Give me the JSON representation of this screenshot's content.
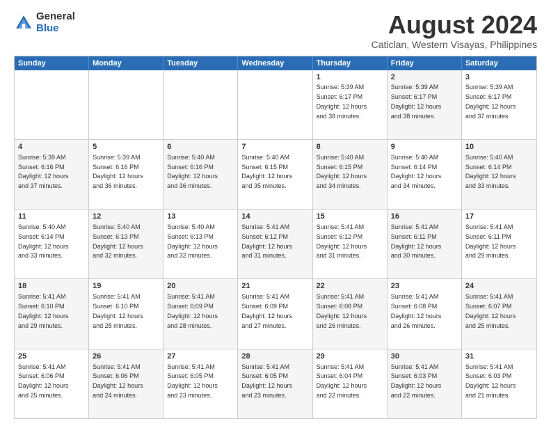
{
  "logo": {
    "general": "General",
    "blue": "Blue"
  },
  "title": "August 2024",
  "location": "Caticlan, Western Visayas, Philippines",
  "header_days": [
    "Sunday",
    "Monday",
    "Tuesday",
    "Wednesday",
    "Thursday",
    "Friday",
    "Saturday"
  ],
  "rows": [
    {
      "cells": [
        {
          "day": "",
          "text": "",
          "empty": true
        },
        {
          "day": "",
          "text": "",
          "empty": true
        },
        {
          "day": "",
          "text": "",
          "empty": true
        },
        {
          "day": "",
          "text": "",
          "empty": true
        },
        {
          "day": "1",
          "text": "Sunrise: 5:39 AM\nSunset: 6:17 PM\nDaylight: 12 hours\nand 38 minutes.",
          "shaded": false
        },
        {
          "day": "2",
          "text": "Sunrise: 5:39 AM\nSunset: 6:17 PM\nDaylight: 12 hours\nand 38 minutes.",
          "shaded": true
        },
        {
          "day": "3",
          "text": "Sunrise: 5:39 AM\nSunset: 6:17 PM\nDaylight: 12 hours\nand 37 minutes.",
          "shaded": false
        }
      ]
    },
    {
      "cells": [
        {
          "day": "4",
          "text": "Sunrise: 5:39 AM\nSunset: 6:16 PM\nDaylight: 12 hours\nand 37 minutes.",
          "shaded": true
        },
        {
          "day": "5",
          "text": "Sunrise: 5:39 AM\nSunset: 6:16 PM\nDaylight: 12 hours\nand 36 minutes.",
          "shaded": false
        },
        {
          "day": "6",
          "text": "Sunrise: 5:40 AM\nSunset: 6:16 PM\nDaylight: 12 hours\nand 36 minutes.",
          "shaded": true
        },
        {
          "day": "7",
          "text": "Sunrise: 5:40 AM\nSunset: 6:15 PM\nDaylight: 12 hours\nand 35 minutes.",
          "shaded": false
        },
        {
          "day": "8",
          "text": "Sunrise: 5:40 AM\nSunset: 6:15 PM\nDaylight: 12 hours\nand 34 minutes.",
          "shaded": true
        },
        {
          "day": "9",
          "text": "Sunrise: 5:40 AM\nSunset: 6:14 PM\nDaylight: 12 hours\nand 34 minutes.",
          "shaded": false
        },
        {
          "day": "10",
          "text": "Sunrise: 5:40 AM\nSunset: 6:14 PM\nDaylight: 12 hours\nand 33 minutes.",
          "shaded": true
        }
      ]
    },
    {
      "cells": [
        {
          "day": "11",
          "text": "Sunrise: 5:40 AM\nSunset: 6:14 PM\nDaylight: 12 hours\nand 33 minutes.",
          "shaded": false
        },
        {
          "day": "12",
          "text": "Sunrise: 5:40 AM\nSunset: 6:13 PM\nDaylight: 12 hours\nand 32 minutes.",
          "shaded": true
        },
        {
          "day": "13",
          "text": "Sunrise: 5:40 AM\nSunset: 6:13 PM\nDaylight: 12 hours\nand 32 minutes.",
          "shaded": false
        },
        {
          "day": "14",
          "text": "Sunrise: 5:41 AM\nSunset: 6:12 PM\nDaylight: 12 hours\nand 31 minutes.",
          "shaded": true
        },
        {
          "day": "15",
          "text": "Sunrise: 5:41 AM\nSunset: 6:12 PM\nDaylight: 12 hours\nand 31 minutes.",
          "shaded": false
        },
        {
          "day": "16",
          "text": "Sunrise: 5:41 AM\nSunset: 6:11 PM\nDaylight: 12 hours\nand 30 minutes.",
          "shaded": true
        },
        {
          "day": "17",
          "text": "Sunrise: 5:41 AM\nSunset: 6:11 PM\nDaylight: 12 hours\nand 29 minutes.",
          "shaded": false
        }
      ]
    },
    {
      "cells": [
        {
          "day": "18",
          "text": "Sunrise: 5:41 AM\nSunset: 6:10 PM\nDaylight: 12 hours\nand 29 minutes.",
          "shaded": true
        },
        {
          "day": "19",
          "text": "Sunrise: 5:41 AM\nSunset: 6:10 PM\nDaylight: 12 hours\nand 28 minutes.",
          "shaded": false
        },
        {
          "day": "20",
          "text": "Sunrise: 5:41 AM\nSunset: 6:09 PM\nDaylight: 12 hours\nand 28 minutes.",
          "shaded": true
        },
        {
          "day": "21",
          "text": "Sunrise: 5:41 AM\nSunset: 6:09 PM\nDaylight: 12 hours\nand 27 minutes.",
          "shaded": false
        },
        {
          "day": "22",
          "text": "Sunrise: 5:41 AM\nSunset: 6:08 PM\nDaylight: 12 hours\nand 26 minutes.",
          "shaded": true
        },
        {
          "day": "23",
          "text": "Sunrise: 5:41 AM\nSunset: 6:08 PM\nDaylight: 12 hours\nand 26 minutes.",
          "shaded": false
        },
        {
          "day": "24",
          "text": "Sunrise: 5:41 AM\nSunset: 6:07 PM\nDaylight: 12 hours\nand 25 minutes.",
          "shaded": true
        }
      ]
    },
    {
      "cells": [
        {
          "day": "25",
          "text": "Sunrise: 5:41 AM\nSunset: 6:06 PM\nDaylight: 12 hours\nand 25 minutes.",
          "shaded": false
        },
        {
          "day": "26",
          "text": "Sunrise: 5:41 AM\nSunset: 6:06 PM\nDaylight: 12 hours\nand 24 minutes.",
          "shaded": true
        },
        {
          "day": "27",
          "text": "Sunrise: 5:41 AM\nSunset: 6:05 PM\nDaylight: 12 hours\nand 23 minutes.",
          "shaded": false
        },
        {
          "day": "28",
          "text": "Sunrise: 5:41 AM\nSunset: 6:05 PM\nDaylight: 12 hours\nand 23 minutes.",
          "shaded": true
        },
        {
          "day": "29",
          "text": "Sunrise: 5:41 AM\nSunset: 6:04 PM\nDaylight: 12 hours\nand 22 minutes.",
          "shaded": false
        },
        {
          "day": "30",
          "text": "Sunrise: 5:41 AM\nSunset: 6:03 PM\nDaylight: 12 hours\nand 22 minutes.",
          "shaded": true
        },
        {
          "day": "31",
          "text": "Sunrise: 5:41 AM\nSunset: 6:03 PM\nDaylight: 12 hours\nand 21 minutes.",
          "shaded": false
        }
      ]
    }
  ]
}
